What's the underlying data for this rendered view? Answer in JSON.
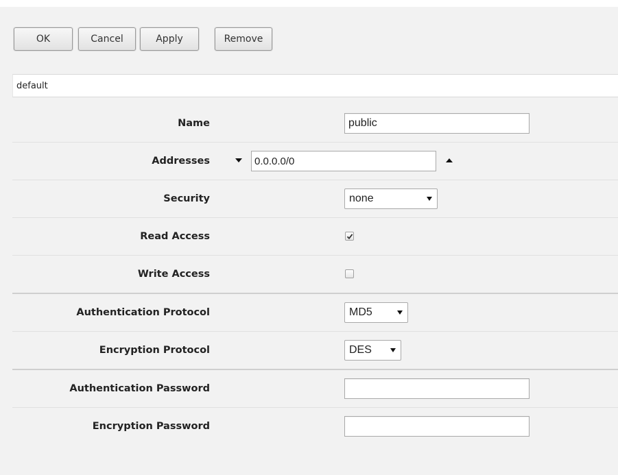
{
  "toolbar": {
    "ok_label": "OK",
    "cancel_label": "Cancel",
    "apply_label": "Apply",
    "remove_label": "Remove"
  },
  "title": "default",
  "form": {
    "name": {
      "label": "Name",
      "value": "public"
    },
    "addresses": {
      "label": "Addresses",
      "value": "0.0.0.0/0"
    },
    "security": {
      "label": "Security",
      "value": "none"
    },
    "read_access": {
      "label": "Read Access",
      "checked": true
    },
    "write_access": {
      "label": "Write Access",
      "checked": false
    },
    "auth_protocol": {
      "label": "Authentication Protocol",
      "value": "MD5"
    },
    "enc_protocol": {
      "label": "Encryption Protocol",
      "value": "DES"
    },
    "auth_password": {
      "label": "Authentication Password",
      "value": ""
    },
    "enc_password": {
      "label": "Encryption Password",
      "value": ""
    }
  },
  "icons": {
    "arrow_down": "arrow-down-icon",
    "arrow_up": "arrow-up-icon",
    "caret": "chevron-down-icon",
    "check": "checkmark-icon"
  }
}
